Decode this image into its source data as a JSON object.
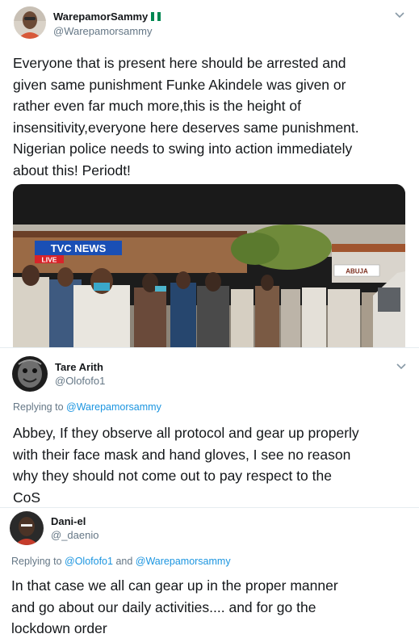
{
  "tweet1": {
    "display_name": "WarepamorSammy",
    "handle": "@Warepamorsammy",
    "flag_colors": [
      "#008751",
      "#ffffff",
      "#008751"
    ],
    "text_lines": [
      "Everyone that is present here should be arrested and",
      "given same punishment Funke Akindele was given or",
      "rather even far much more,this is the height of",
      "insensitivity,everyone here deserves same punishment.",
      "Nigerian police needs to swing into action immediately",
      "about this! Periodt!"
    ],
    "media": {
      "overlay_logo": "TVC NEWS",
      "overlay_live": "LIVE",
      "sign_text": "ABUJA"
    }
  },
  "tweet2": {
    "display_name": "Tare Arith",
    "handle": "@Olofofo1",
    "replying_prefix": "Replying to ",
    "replying_to": "@Warepamorsammy",
    "text_lines": [
      "Abbey, If they observe all protocol and gear up properly",
      "with their face mask  and hand gloves, I see no reason",
      "why they should not come out to pay respect to the",
      "CoS"
    ]
  },
  "tweet3": {
    "display_name": "Dani-el",
    "handle": "@_daenio",
    "replying_prefix": "Replying to ",
    "replying_to_1": "@Olofofo1",
    "replying_and": " and ",
    "replying_to_2": "@Warepamorsammy",
    "text_lines": [
      "In that case we all can gear up in the proper manner",
      "and go about our daily activities.... and for go the",
      "lockdown order"
    ]
  },
  "colors": {
    "link": "#1b95e0",
    "muted": "#657786",
    "text": "#14171a",
    "tvc_blue": "#1a4fb5",
    "live_red": "#d8232a"
  },
  "icons": [
    "chevron-down-icon",
    "nigeria-flag-icon"
  ]
}
